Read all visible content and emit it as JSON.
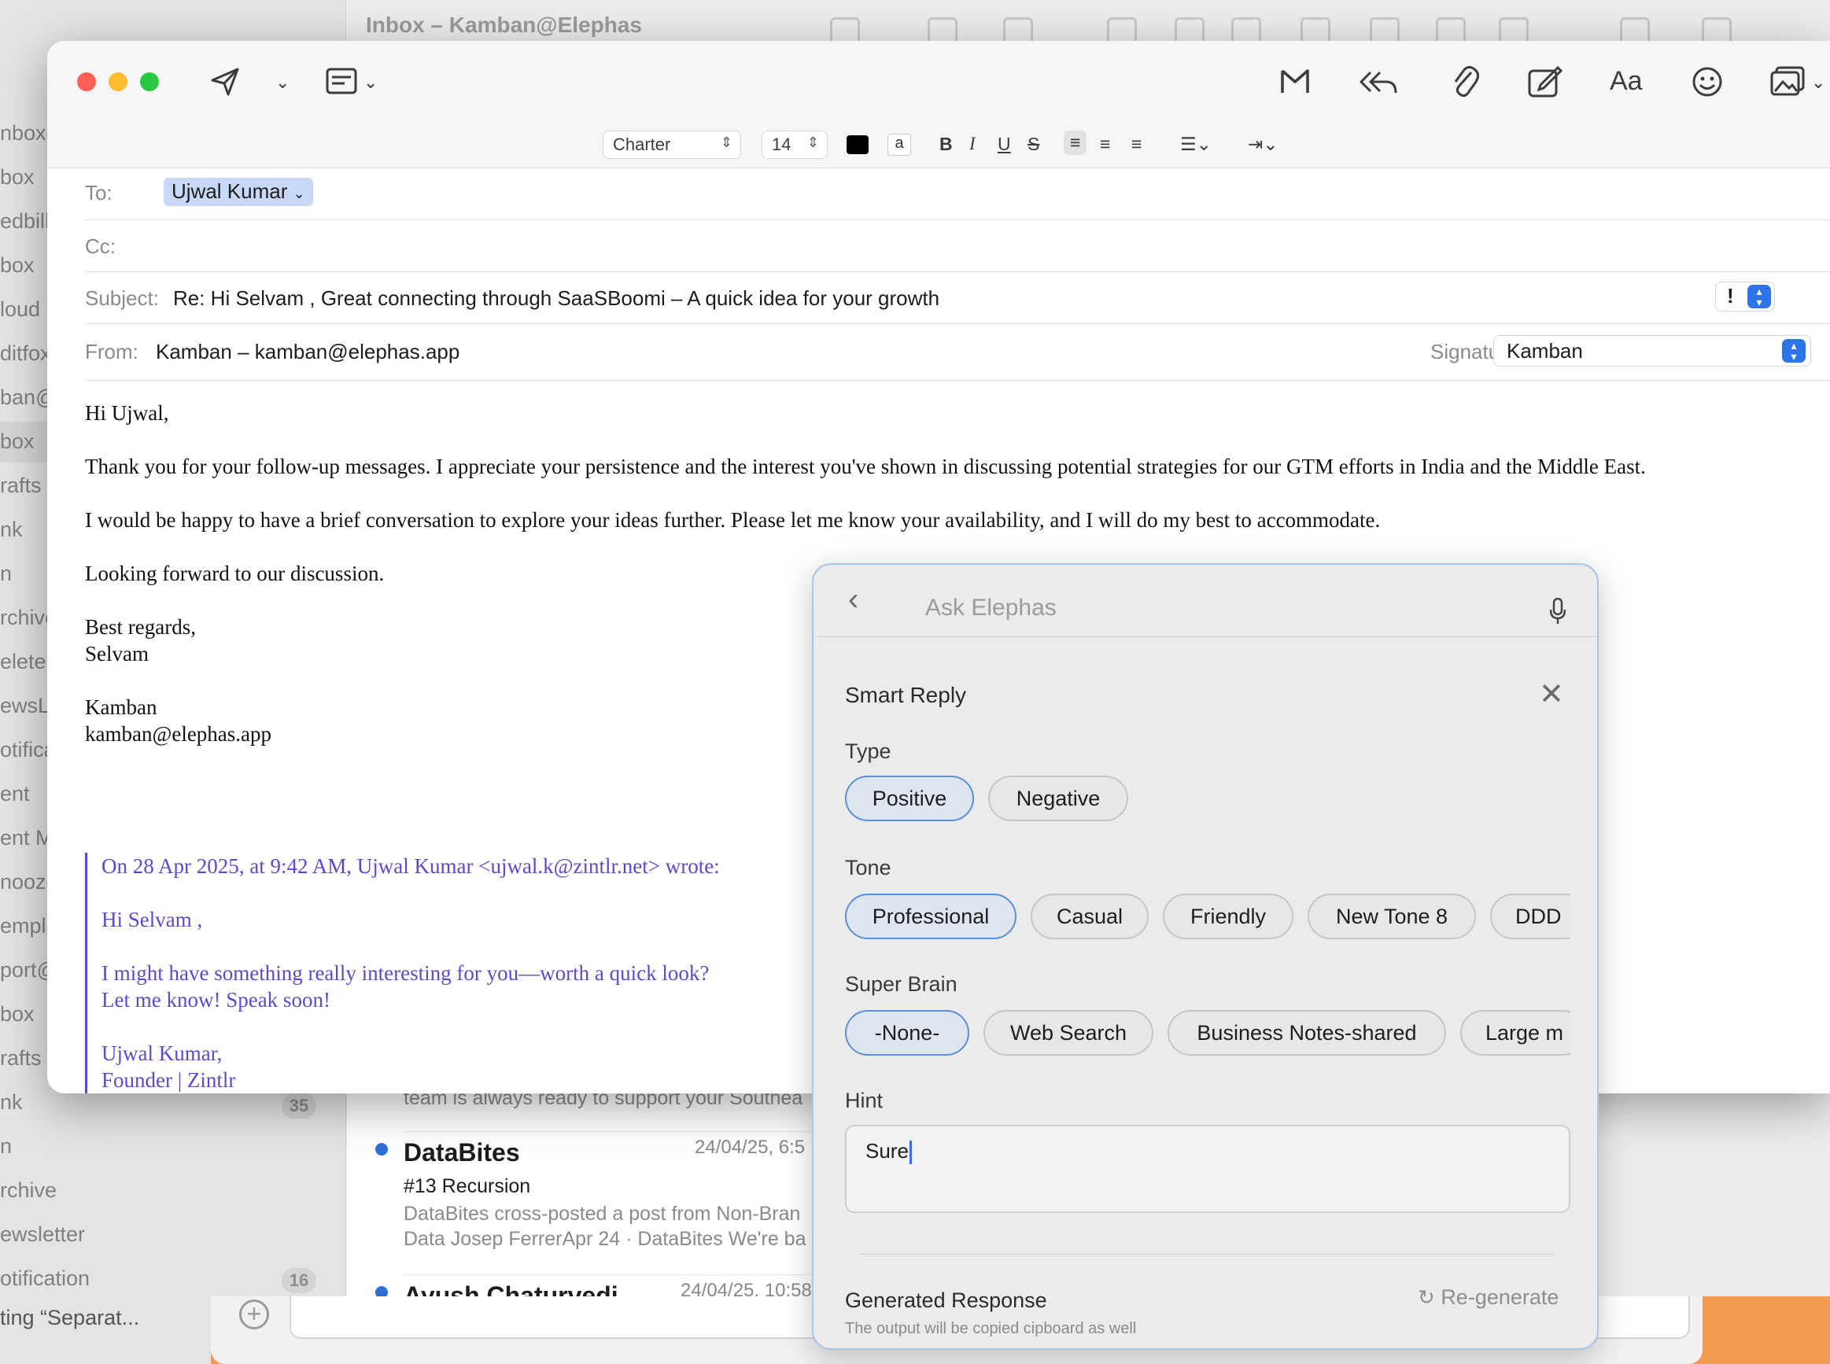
{
  "background": {
    "window_title": "Inbox – Kamban@Elephas",
    "sidebar_items": [
      {
        "label": "nboxe",
        "selected": false
      },
      {
        "label": "box",
        "selected": false
      },
      {
        "label": "edbill",
        "selected": false
      },
      {
        "label": "box",
        "selected": false
      },
      {
        "label": "loud",
        "selected": false
      },
      {
        "label": "ditfox",
        "selected": false
      },
      {
        "label": "ban@",
        "selected": false
      },
      {
        "label": "box",
        "selected": true
      },
      {
        "label": "rafts",
        "selected": false
      },
      {
        "label": "nk",
        "selected": false
      },
      {
        "label": "n",
        "selected": false
      },
      {
        "label": "rchive",
        "selected": false
      },
      {
        "label": "elete",
        "selected": false
      },
      {
        "label": "ewsL",
        "selected": false
      },
      {
        "label": "otifica",
        "selected": false
      },
      {
        "label": "ent",
        "selected": false
      },
      {
        "label": "ent M",
        "selected": false
      },
      {
        "label": "nooze",
        "selected": false
      },
      {
        "label": "empla",
        "selected": false
      },
      {
        "label": "port@",
        "selected": false
      },
      {
        "label": "box",
        "selected": false
      },
      {
        "label": "rafts",
        "selected": false
      },
      {
        "label": "nk",
        "selected": false
      },
      {
        "label": "n",
        "selected": false
      },
      {
        "label": "rchive",
        "selected": false
      },
      {
        "label": "ewsletter",
        "selected": false
      },
      {
        "label": "otification",
        "selected": false
      }
    ],
    "counts": {
      "junk": "35",
      "notification": "16"
    },
    "status_text": "ting “Separat...",
    "messages": [
      {
        "sender": "",
        "date": "",
        "subject": "",
        "preview": "team is always ready to support your Southea"
      },
      {
        "sender": "DataBites",
        "date": "24/04/25, 6:5",
        "subject": "#13 Recursion",
        "preview": "DataBites cross-posted a post from Non-Bran Data Josep FerrerApr 24 · DataBites We're ba"
      },
      {
        "sender": "Ayush Chaturvedi",
        "date": "24/04/25, 10:58",
        "subject": "",
        "preview": ""
      }
    ]
  },
  "compose": {
    "font_name": "Charter",
    "font_size": "14",
    "text_color": "#000000",
    "to_label": "To:",
    "to_value": "Ujwal Kumar",
    "cc_label": "Cc:",
    "subject_label": "Subject:",
    "subject_value": "Re: Hi Selvam , Great connecting through SaaSBoomi – A quick idea for your growth",
    "priority": "!",
    "from_label": "From:",
    "from_value": "Kamban – kamban@elephas.app",
    "signature_label": "Signature:",
    "signature_value": "Kamban",
    "body": {
      "greeting": "Hi Ujwal,",
      "p1": "Thank you for your follow-up messages. I appreciate your persistence and the interest you've shown in discussing potential strategies for our GTM efforts in India and the Middle East.",
      "p2": "I would be happy to have a brief conversation to explore your ideas further. Please let me know your availability, and I will do my best to accommodate.",
      "p3": "Looking forward to our discussion.",
      "closing_1": "Best regards,",
      "closing_2": "Selvam",
      "sig_1": "Kamban",
      "sig_2": "kamban@elephas.app"
    },
    "quote": {
      "header": "On 28 Apr 2025, at 9:42 AM, Ujwal Kumar <ujwal.k@zintlr.net> wrote:",
      "greeting": "Hi Selvam ,",
      "line1": "I might have something really interesting for you—worth a quick look?",
      "line2": "Let me know! Speak soon!",
      "sig_1": "Ujwal Kumar,",
      "sig_2": "Founder | Zintlr"
    }
  },
  "elephas": {
    "search_placeholder": "Ask Elephas",
    "section_title": "Smart Reply",
    "type_label": "Type",
    "types": [
      "Positive",
      "Negative"
    ],
    "tone_label": "Tone",
    "tones": [
      "Professional",
      "Casual",
      "Friendly",
      "New Tone 8",
      "DDD"
    ],
    "brain_label": "Super Brain",
    "brains": [
      "-None-",
      "Web Search",
      "Business Notes-shared",
      "Large m"
    ],
    "hint_label": "Hint",
    "hint_value": "Sure",
    "generated_title": "Generated Response",
    "regenerate_label": "Re-generate",
    "generated_note": "The output will be copied cipboard as well",
    "accent": "#5b8fd6"
  }
}
